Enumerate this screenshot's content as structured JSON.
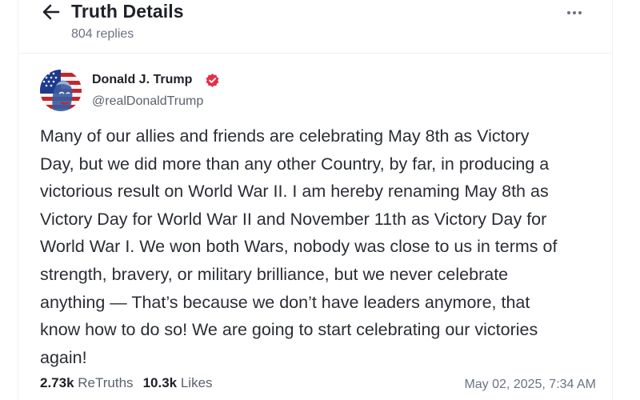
{
  "header": {
    "title": "Truth Details",
    "replies": "804 replies",
    "back_icon": "arrow-left-icon",
    "more_icon": "ellipsis-icon"
  },
  "post": {
    "author": {
      "name": "Donald J. Trump",
      "handle": "@realDonaldTrump",
      "verified_icon": "verified-badge-icon",
      "verified_color": "#e0314b"
    },
    "body": "Many of our allies and friends are celebrating May 8th as Victory\nDay, but we did more than any other Country, by far, in producing a\nvictorious result on World War II. I am hereby renaming May 8th as\nVictory Day for World War II and November 11th as Victory Day for\nWorld War I. We won both Wars, nobody was close to us in terms of\nstrength, bravery, or military brilliance, but we never celebrate\nanything — That’s because we don’t have leaders  anymore, that\nknow how to do so! We are going to start celebrating our victories\nagain!",
    "stats": {
      "retruths_count": "2.73k",
      "retruths_label": "ReTruths",
      "likes_count": "10.3k",
      "likes_label": "Likes"
    },
    "timestamp": "May 02, 2025, 7:34 AM"
  }
}
